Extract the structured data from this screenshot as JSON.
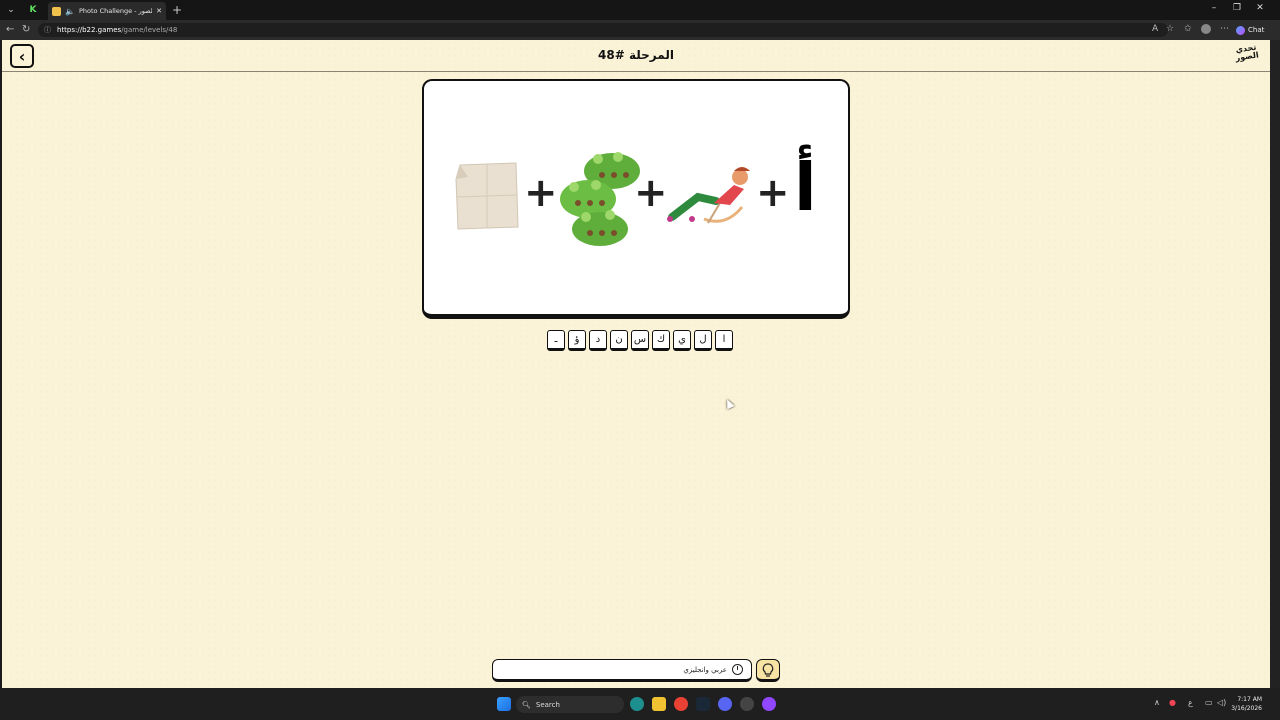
{
  "browser": {
    "tab_title": "Photo Challenge - تحدي الصور",
    "tab_close": "✕",
    "new_tab": "+",
    "url_host": "https://b22.games",
    "url_path": "/game/levels/48",
    "chat_label": "Chat",
    "minimize": "–",
    "restore": "❐",
    "close": "✕"
  },
  "header": {
    "back_symbol": "‹",
    "level_title": "المرحلة #48",
    "logo_text": "تحدي الصور"
  },
  "puzzle": {
    "plus": "+",
    "alif": "أ"
  },
  "letters": [
    "ـ",
    "ؤ",
    "د",
    "ن",
    "س",
    "ك",
    "ي",
    "ل",
    "ا"
  ],
  "bottom": {
    "mode_label": "عربي وانجليزي"
  },
  "taskbar": {
    "search_label": "Search",
    "time": "7:17 AM",
    "date": "3/16/2026",
    "lang": "ع"
  },
  "colors": {
    "page_bg": "#fbf3d7",
    "hint_bg": "#f7e3a3"
  }
}
